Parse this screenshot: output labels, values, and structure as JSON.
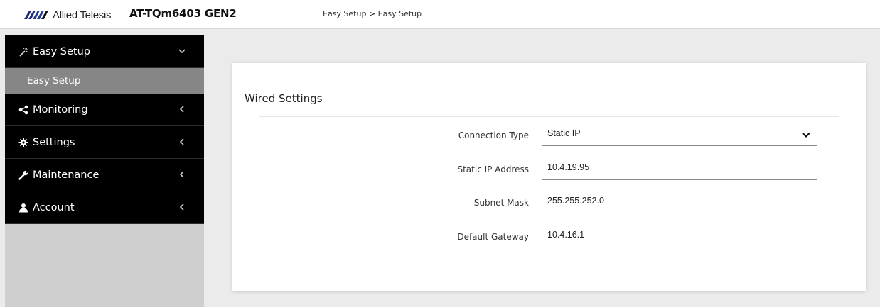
{
  "header": {
    "brand_name": "Allied Telesis",
    "device_model": "AT-TQm6403 GEN2",
    "breadcrumb": "Easy Setup > Easy Setup"
  },
  "sidebar": {
    "items": [
      {
        "label": "Easy Setup",
        "icon": "wand-icon",
        "expanded": true,
        "children": [
          {
            "label": "Easy Setup",
            "active": true
          }
        ]
      },
      {
        "label": "Monitoring",
        "icon": "share-icon",
        "expanded": false
      },
      {
        "label": "Settings",
        "icon": "gear-icon",
        "expanded": false
      },
      {
        "label": "Maintenance",
        "icon": "wrench-icon",
        "expanded": false
      },
      {
        "label": "Account",
        "icon": "user-icon",
        "expanded": false
      }
    ]
  },
  "main": {
    "card_title": "Wired Settings",
    "fields": [
      {
        "label": "Connection Type",
        "value": "Static IP",
        "type": "select"
      },
      {
        "label": "Static IP Address",
        "value": "10.4.19.95",
        "type": "text"
      },
      {
        "label": "Subnet Mask",
        "value": "255.255.252.0",
        "type": "text"
      },
      {
        "label": "Default Gateway",
        "value": "10.4.16.1",
        "type": "text"
      }
    ]
  },
  "colors": {
    "sidebar_item_bg": "#000000",
    "sidebar_sub_active_bg": "#868686",
    "sidebar_bg": "#cfcfcf",
    "page_bg": "#ebebeb",
    "logo_blue": "#2a3b8f"
  }
}
